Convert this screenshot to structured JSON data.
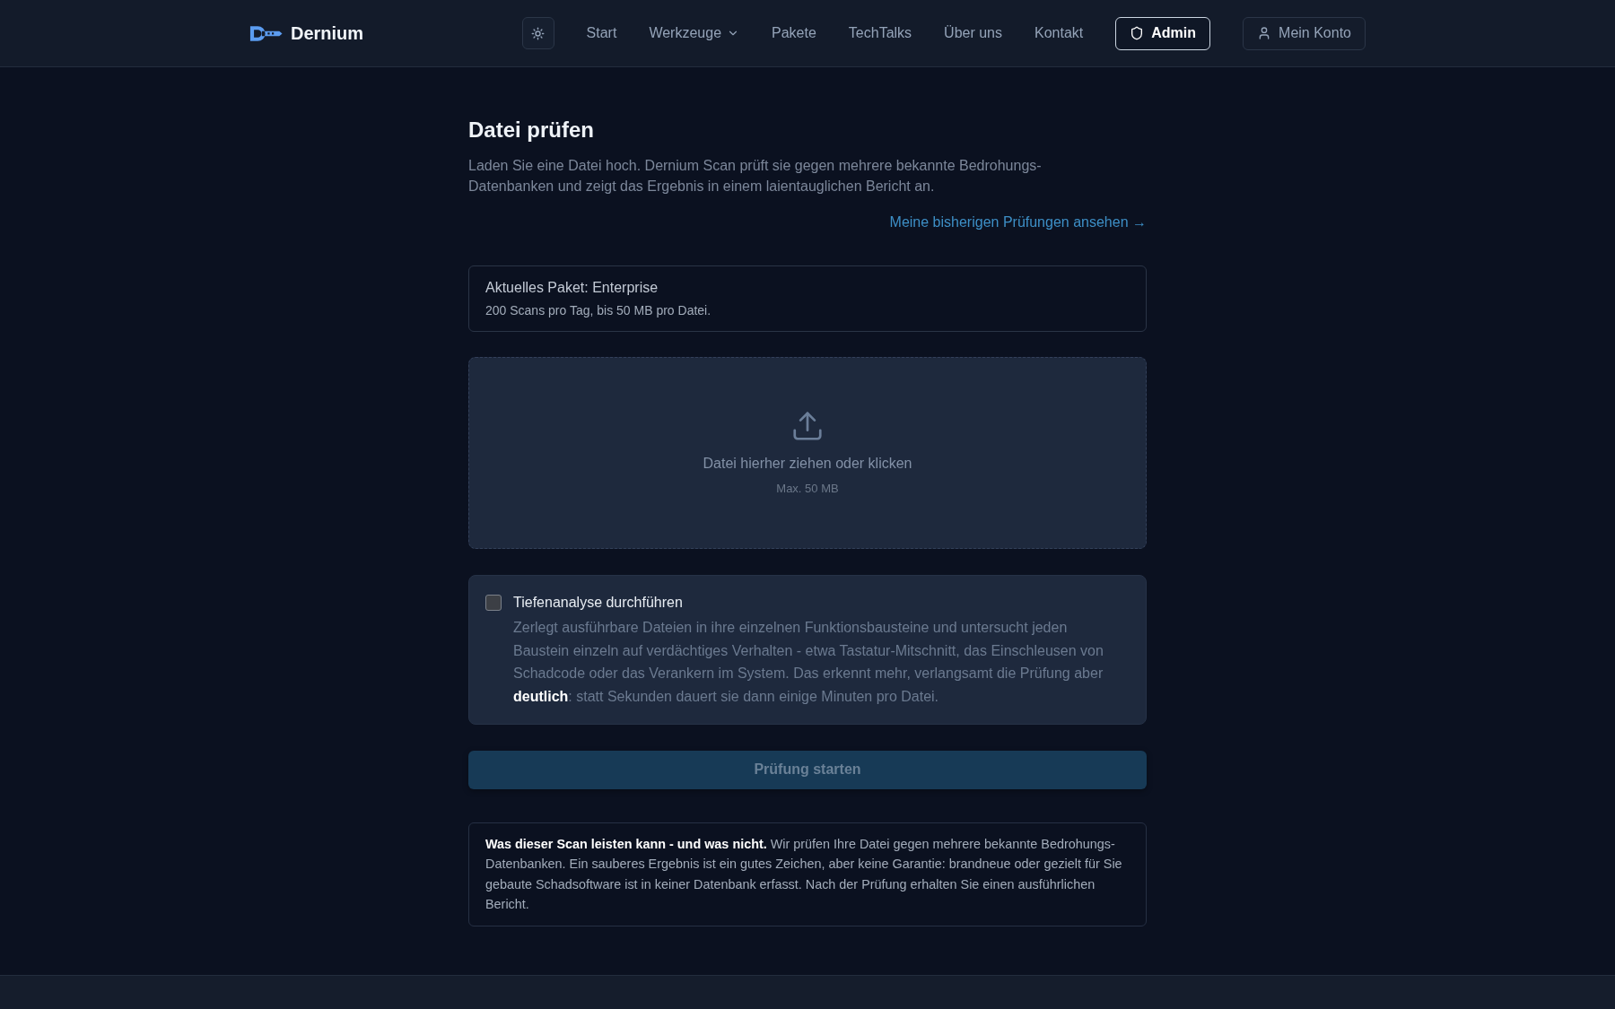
{
  "header": {
    "brand": "Dernium",
    "nav": [
      {
        "label": "Start",
        "kind": "link"
      },
      {
        "label": "Werkzeuge",
        "kind": "dropdown"
      },
      {
        "label": "Pakete",
        "kind": "link"
      },
      {
        "label": "TechTalks",
        "kind": "link"
      },
      {
        "label": "Über uns",
        "kind": "link"
      },
      {
        "label": "Kontakt",
        "kind": "link"
      }
    ],
    "buttons": [
      {
        "label": "Admin",
        "kind": "admin"
      },
      {
        "label": "Mein Konto",
        "kind": "account"
      }
    ]
  },
  "page": {
    "title": "Datei prüfen",
    "description": "Laden Sie eine Datei hoch. Dernium Scan prüft sie gegen mehrere bekannte Bedrohungs-Datenbanken und zeigt das Ergebnis in einem laientauglichen Bericht an.",
    "history_link": "Meine bisherigen Prüfungen ansehen →"
  },
  "plan_card": {
    "title": "Aktuelles Paket: Enterprise",
    "details": "200 Scans pro Tag, bis 50 MB pro Datei."
  },
  "upload": {
    "prompt": "Datei hierher ziehen oder klicken",
    "limit": "Max. 50 MB"
  },
  "deep_analysis": {
    "label": "Tiefenanalyse durchführen",
    "checked": false,
    "description": "Zerlegt ausführbare Dateien in ihre einzelnen Funktionsbausteine und untersucht jeden Baustein einzeln auf verdächtiges Verhalten - etwa Tastatur-Mitschnitt, das Einschleusen von Schadcode oder das Verankern im System. Das erkennt mehr, verlangsamt die Prüfung aber **deutlich**: statt Sekunden dauert sie dann einige Minuten pro Datei."
  },
  "start_button": {
    "label": "Prüfung starten",
    "disabled": true
  },
  "notice": {
    "text": "**Was dieser Scan leisten kann - und was nicht.** Wir prüfen Ihre Datei gegen mehrere bekannte Bedrohungs-Datenbanken. Ein sauberes Ergebnis ist ein gutes Zeichen, aber keine Garantie: brandneue oder gezielt für Sie gebaute Schadsoftware ist in keiner Datenbank erfasst. Nach der Prüfung erhalten Sie einen ausführlichen Bericht."
  }
}
